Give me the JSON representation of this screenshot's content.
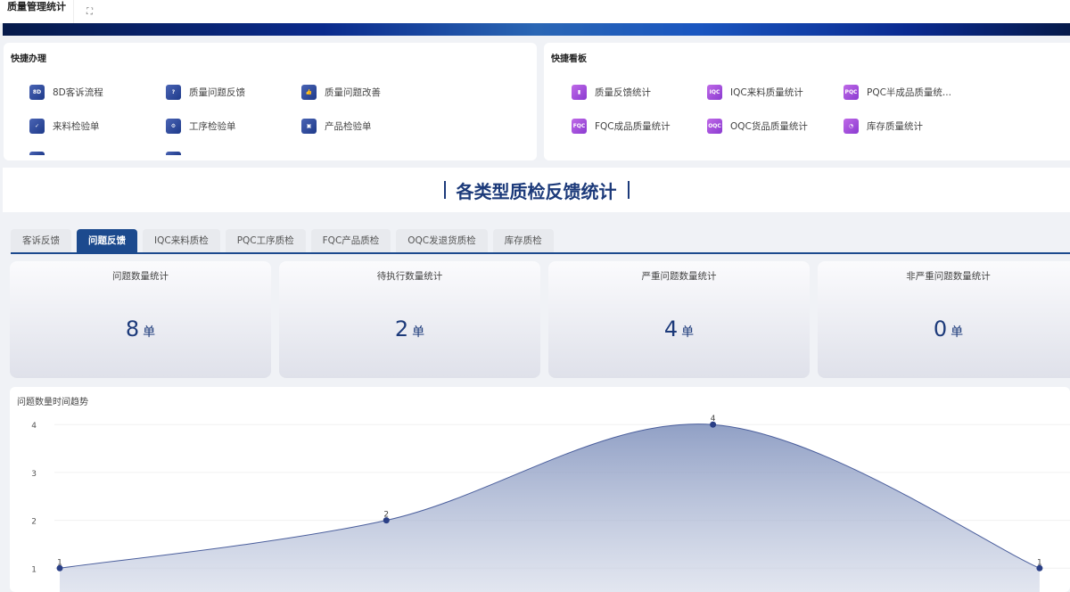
{
  "topbar": {
    "title": "质量管理统计",
    "fullscreen_icon": "expand-icon"
  },
  "quick_actions": {
    "title": "快捷办理",
    "items": [
      {
        "label": "8D客诉流程",
        "icon": "8D"
      },
      {
        "label": "质量问题反馈",
        "icon": "?"
      },
      {
        "label": "质量问题改善",
        "icon": "👍"
      },
      {
        "label": "来料检验单",
        "icon": "✓"
      },
      {
        "label": "工序检验单",
        "icon": "⚙"
      },
      {
        "label": "产品检验单",
        "icon": "▣"
      }
    ]
  },
  "quick_boards": {
    "title": "快捷看板",
    "items": [
      {
        "label": "质量反馈统计",
        "icon": "▮"
      },
      {
        "label": "IQC来料质量统计",
        "icon": "IQC"
      },
      {
        "label": "PQC半成品质量统...",
        "icon": "PQC"
      },
      {
        "label": "FQC成品质量统计",
        "icon": "FQC"
      },
      {
        "label": "OQC货品质量统计",
        "icon": "OQC"
      },
      {
        "label": "库存质量统计",
        "icon": "◔"
      }
    ]
  },
  "section_title": "各类型质检反馈统计",
  "tabs": [
    "客诉反馈",
    "问题反馈",
    "IQC来料质检",
    "PQC工序质检",
    "FQC产品质检",
    "OQC发退货质检",
    "库存质检"
  ],
  "active_tab": 1,
  "cards": [
    {
      "title": "问题数量统计",
      "value": "8",
      "unit": "单"
    },
    {
      "title": "待执行数量统计",
      "value": "2",
      "unit": "单"
    },
    {
      "title": "严重问题数量统计",
      "value": "4",
      "unit": "单"
    },
    {
      "title": "非严重问题数量统计",
      "value": "0",
      "unit": "单"
    }
  ],
  "colors": {
    "primary": "#1c4a8e",
    "accent_purple": "#a050dc"
  },
  "chart_data": {
    "type": "area",
    "title": "问题数量时间趋势",
    "y_ticks": [
      1,
      2,
      3,
      4
    ],
    "ylim": [
      0,
      4
    ],
    "x_index": [
      0,
      1,
      2,
      3
    ],
    "values": [
      1,
      2,
      4,
      1
    ],
    "data_labels": [
      "1",
      "2",
      "4",
      "1"
    ]
  }
}
